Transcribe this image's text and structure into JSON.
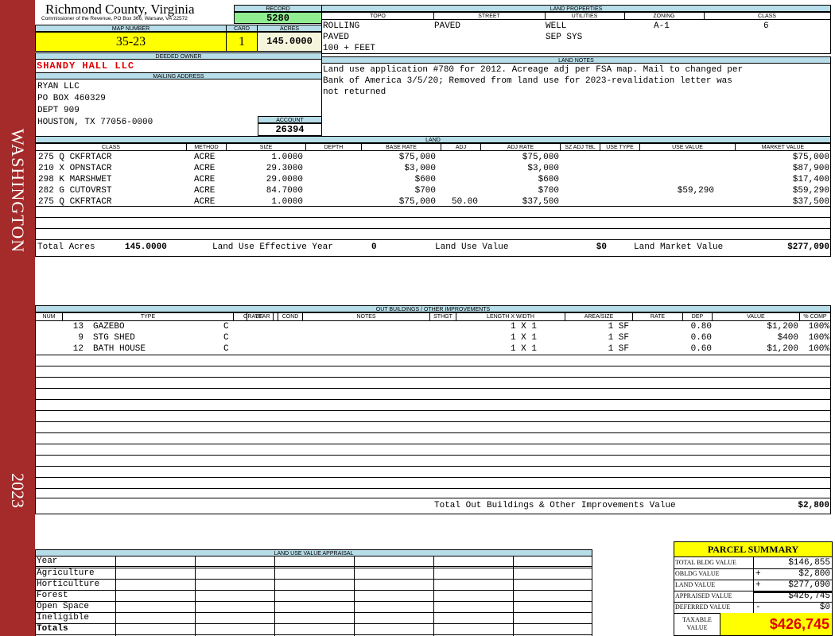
{
  "sidebar": {
    "district": "WASHINGTON",
    "year": "2023",
    "color": "#a52a2a"
  },
  "county": {
    "name": "Richmond County, Virginia",
    "sub": "Commissioner of the Revenue, PO Box 366, Warsaw, VA 22572"
  },
  "record": {
    "label": "RECORD",
    "value": "5280"
  },
  "map": {
    "label": "MAP NUMBER",
    "value": "35-23"
  },
  "card": {
    "label": "CARD",
    "value": "1"
  },
  "acres": {
    "label": "ACRES",
    "value": "145.0000"
  },
  "owner": {
    "label": "DEEDED OWNER",
    "value": "SHANDY HALL LLC"
  },
  "mailing": {
    "label": "MAILING ADDRESS",
    "lines": [
      "RYAN LLC",
      "PO BOX 460329",
      "DEPT 909",
      "HOUSTON, TX 77056-0000"
    ]
  },
  "account": {
    "label": "ACCOUNT",
    "value": "26394"
  },
  "land_properties": {
    "label": "LAND PROPERTIES",
    "headers": [
      "TOPO",
      "STREET",
      "UTILITIES",
      "ZONING",
      "CLASS"
    ],
    "topo": [
      "ROLLING",
      "PAVED",
      "100 + FEET"
    ],
    "street": "PAVED",
    "utilities": [
      "WELL",
      "SEP SYS"
    ],
    "zoning": "A-1",
    "class": "6"
  },
  "land_notes": {
    "label": "LAND NOTES",
    "lines": [
      "Land use application #780 for 2012. Acreage adj per FSA map. Mail to changed per",
      "Bank of America 3/5/20; Removed from land use for 2023-revalidation letter was",
      "not returned"
    ]
  },
  "land": {
    "label": "LAND",
    "headers": [
      "CLASS",
      "METHOD",
      "SIZE",
      "DEPTH",
      "BASE RATE",
      "ADJ",
      "ADJ RATE",
      "SZ ADJ TBL",
      "USE TYPE",
      "USE VALUE",
      "MARKET VALUE"
    ],
    "rows": [
      [
        "275 Q CKFRTACR",
        "ACRE",
        "1.0000",
        "",
        "$75,000",
        "",
        "$75,000",
        "",
        "",
        "",
        "$75,000"
      ],
      [
        "210 X OPNSTACR",
        "ACRE",
        "29.3000",
        "",
        "$3,000",
        "",
        "$3,000",
        "",
        "",
        "",
        "$87,900"
      ],
      [
        "298 K MARSHWET",
        "ACRE",
        "29.0000",
        "",
        "$600",
        "",
        "$600",
        "",
        "",
        "",
        "$17,400"
      ],
      [
        "282 G CUTOVRST",
        "ACRE",
        "84.7000",
        "",
        "$700",
        "",
        "$700",
        "",
        "",
        "$59,290",
        "$59,290"
      ],
      [
        "275 Q CKFRTACR",
        "ACRE",
        "1.0000",
        "",
        "$75,000",
        "50.00",
        "$37,500",
        "",
        "",
        "",
        "$37,500"
      ]
    ],
    "totals": {
      "total_acres_label": "Total Acres",
      "total_acres": "145.0000",
      "luey_label": "Land Use Effective Year",
      "luey": "0",
      "luv_label": "Land Use Value",
      "luv": "$0",
      "lmv_label": "Land Market Value",
      "lmv": "$277,090"
    }
  },
  "outbuildings": {
    "label": "OUT BUILDINGS / OTHER IMPROVEMENTS",
    "headers": [
      "NUM",
      "TYPE",
      "GRADE",
      "YEAR",
      "COND",
      "NOTES",
      "STHGT",
      "LENGTH X WIDTH",
      "AREA/SIZE",
      "RATE",
      "DEP",
      "VALUE",
      "% COMP"
    ],
    "rows": [
      [
        "13",
        "GAZEBO",
        "C",
        "",
        "",
        "",
        "",
        "1 X 1",
        "1 SF",
        "",
        "0.80",
        "$1,200",
        "100%"
      ],
      [
        "9",
        "STG SHED",
        "C",
        "",
        "",
        "",
        "",
        "1 X 1",
        "1 SF",
        "",
        "0.60",
        "$400",
        "100%"
      ],
      [
        "12",
        "BATH HOUSE",
        "C",
        "",
        "",
        "",
        "",
        "1 X 1",
        "1 SF",
        "",
        "0.60",
        "$1,200",
        "100%"
      ]
    ],
    "total_label": "Total Out Buildings & Other Improvements Value",
    "total": "$2,800"
  },
  "land_use_appraisal": {
    "label": "LAND USE VALUE APPRAISAL",
    "rows": [
      "Year",
      "Agriculture",
      "Horticulture",
      "Forest",
      "Open Space",
      "Ineligible",
      "Totals"
    ]
  },
  "parcel_summary": {
    "title": "PARCEL SUMMARY",
    "rows": [
      {
        "label": "TOTAL BLDG VALUE",
        "sign": "",
        "value": "$146,855"
      },
      {
        "label": "OBLDG VALUE",
        "sign": "+",
        "value": "$2,800"
      },
      {
        "label": "LAND VALUE",
        "sign": "+",
        "value": "$277,090"
      },
      {
        "label": "APPRAISED VALUE",
        "sign": "",
        "value": "$426,745"
      },
      {
        "label": "DEFERRED VALUE",
        "sign": "-",
        "value": "$0"
      }
    ],
    "taxable_label_1": "TAXABLE",
    "taxable_label_2": "VALUE",
    "taxable_value": "$426,745"
  },
  "colors": {
    "header_blue": "#b7dde8",
    "yellow": "#ffff00",
    "green": "#90ee90",
    "cream": "#f5f5dc",
    "red": "#e00000"
  }
}
